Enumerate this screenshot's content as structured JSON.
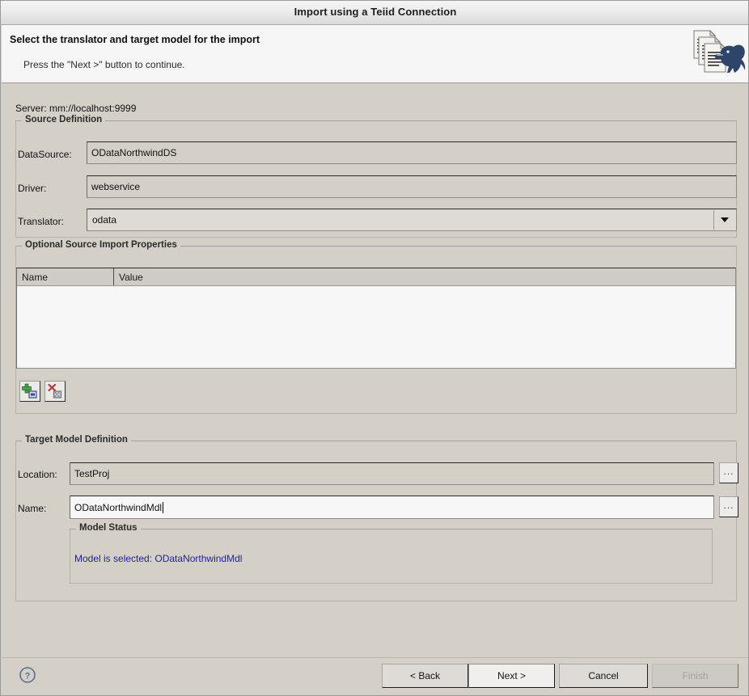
{
  "window": {
    "title": "Import using a Teiid Connection"
  },
  "header": {
    "title": "Select the translator and target model for the import",
    "subtitle": "Press the \"Next >\" button to continue.",
    "banner_icon": "teiid-dinosaur-documents-banner"
  },
  "server": {
    "label": "Server: mm://localhost:9999"
  },
  "source_definition": {
    "group_title": "Source Definition",
    "datasource": {
      "label": "DataSource:",
      "value": "ODataNorthwindDS"
    },
    "driver": {
      "label": "Driver:",
      "value": "webservice"
    },
    "translator": {
      "label": "Translator:",
      "value": "odata",
      "dropdown_icon": "chevron-down-icon"
    }
  },
  "optional_properties": {
    "group_title": "Optional Source Import Properties",
    "columns": [
      "Name",
      "Value"
    ],
    "rows": [],
    "add_button": {
      "icon": "add-property-icon"
    },
    "remove_button": {
      "icon": "remove-property-icon"
    }
  },
  "target_model": {
    "group_title": "Target Model Definition",
    "location": {
      "label": "Location:",
      "value": "TestProj",
      "browse_label": "..."
    },
    "name": {
      "label": "Name:",
      "value": "ODataNorthwindMdl",
      "browse_label": "..."
    },
    "model_status": {
      "group_title": "Model Status",
      "message": "Model is selected: ODataNorthwindMdl",
      "color": "#1f1f9e"
    }
  },
  "footer": {
    "help_icon": "help-question-icon",
    "buttons": [
      {
        "label": "< Back",
        "state": "enabled"
      },
      {
        "label": "Next >",
        "state": "default"
      },
      {
        "label": "Cancel",
        "state": "enabled"
      },
      {
        "label": "Finish",
        "state": "disabled"
      }
    ]
  }
}
